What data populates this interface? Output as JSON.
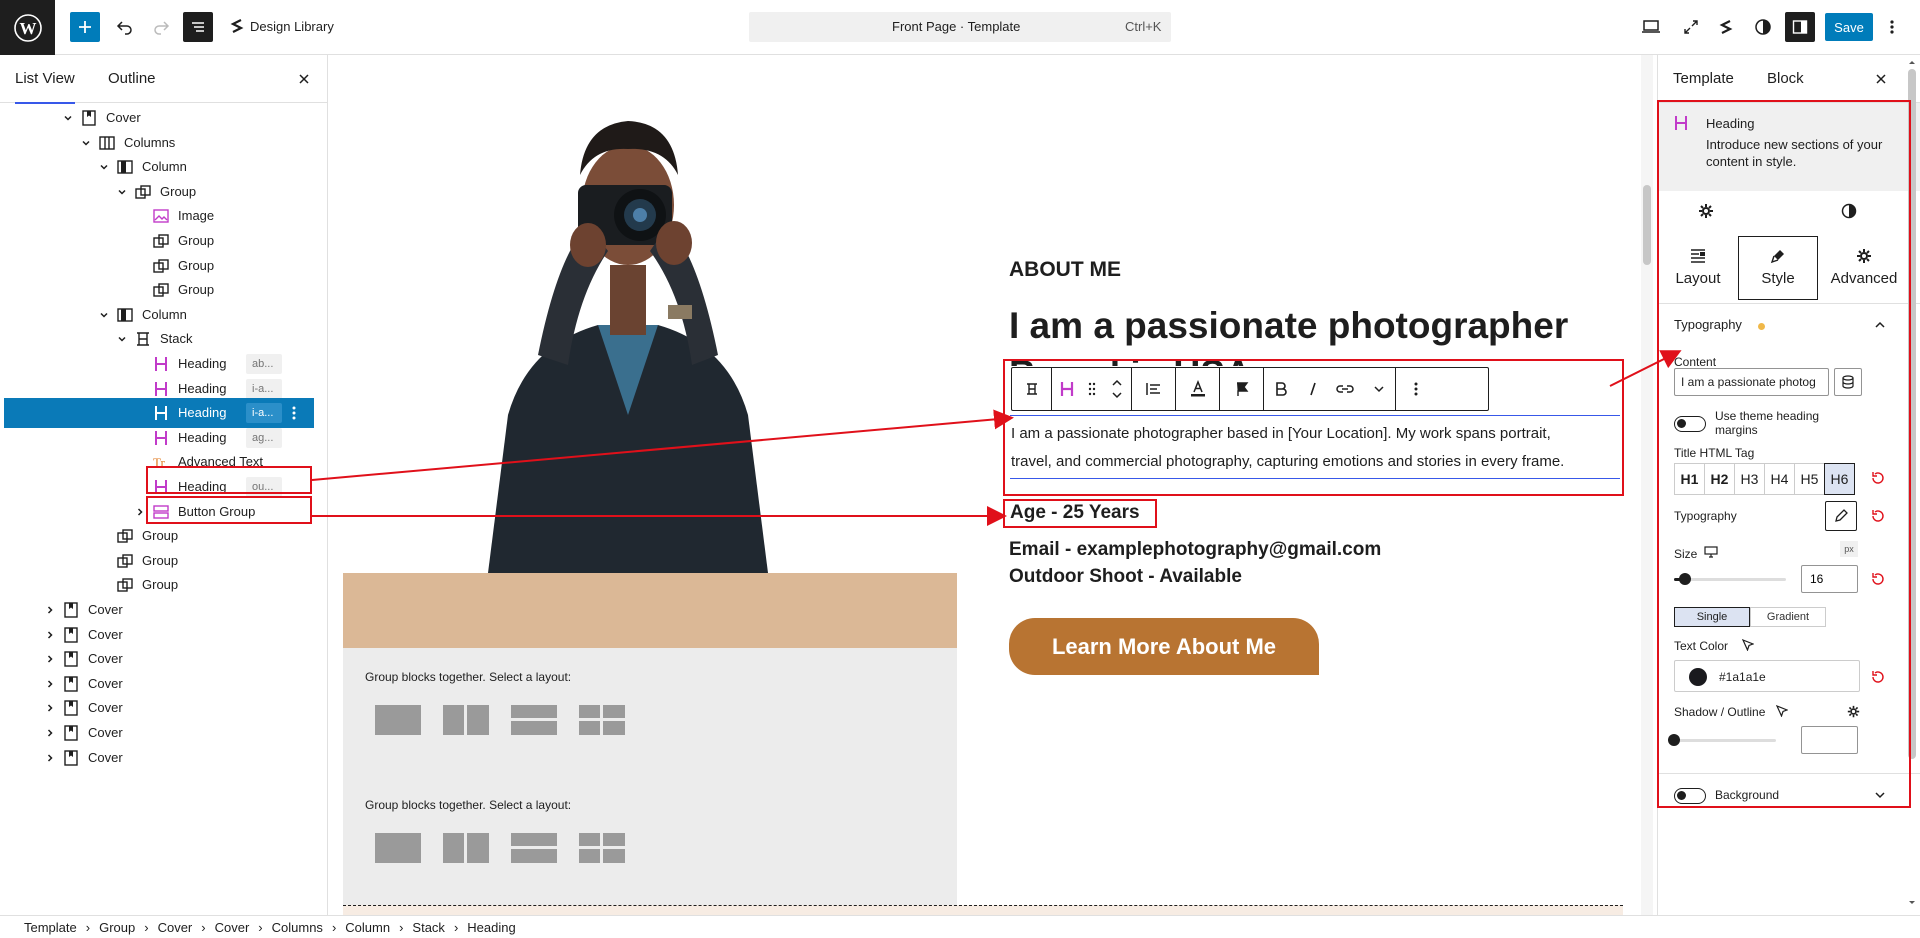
{
  "topbar": {
    "design_library": "Design Library",
    "doc_title": "Front Page · Template",
    "shortcut": "Ctrl+K",
    "save": "Save"
  },
  "left_panel": {
    "tabs": [
      "List View",
      "Outline"
    ],
    "rows": [
      {
        "label": "Cover",
        "icon": "cover-icon",
        "pill": ""
      },
      {
        "label": "Columns",
        "icon": "columns-icon",
        "pill": ""
      },
      {
        "label": "Column",
        "icon": "column-icon",
        "pill": ""
      },
      {
        "label": "Group",
        "icon": "group-icon",
        "pill": ""
      },
      {
        "label": "Image",
        "icon": "image-icon",
        "pill": ""
      },
      {
        "label": "Group",
        "icon": "group-icon",
        "pill": ""
      },
      {
        "label": "Group",
        "icon": "group-icon",
        "pill": ""
      },
      {
        "label": "Group",
        "icon": "group-icon",
        "pill": ""
      },
      {
        "label": "Column",
        "icon": "column-icon",
        "pill": ""
      },
      {
        "label": "Stack",
        "icon": "stack-icon",
        "pill": ""
      },
      {
        "label": "Heading",
        "icon": "heading-icon",
        "pill": "ab..."
      },
      {
        "label": "Heading",
        "icon": "heading-icon",
        "pill": "i-a..."
      },
      {
        "label": "Heading",
        "icon": "heading-icon",
        "pill": "i-a..."
      },
      {
        "label": "Heading",
        "icon": "heading-icon",
        "pill": "ag..."
      },
      {
        "label": "Advanced Text",
        "icon": "advanced-text-icon",
        "pill": ""
      },
      {
        "label": "Heading",
        "icon": "heading-icon",
        "pill": "ou..."
      },
      {
        "label": "Button Group",
        "icon": "button-group-icon",
        "pill": ""
      },
      {
        "label": "Group",
        "icon": "group-icon",
        "pill": ""
      },
      {
        "label": "Group",
        "icon": "group-icon",
        "pill": ""
      },
      {
        "label": "Group",
        "icon": "group-icon",
        "pill": ""
      },
      {
        "label": "Cover",
        "icon": "cover-icon",
        "pill": ""
      },
      {
        "label": "Cover",
        "icon": "cover-icon",
        "pill": ""
      },
      {
        "label": "Cover",
        "icon": "cover-icon",
        "pill": ""
      },
      {
        "label": "Cover",
        "icon": "cover-icon",
        "pill": ""
      },
      {
        "label": "Cover",
        "icon": "cover-icon",
        "pill": ""
      },
      {
        "label": "Cover",
        "icon": "cover-icon",
        "pill": ""
      },
      {
        "label": "Cover",
        "icon": "cover-icon",
        "pill": ""
      }
    ]
  },
  "canvas": {
    "about_label": "ABOUT ME",
    "headline": "I am a passionate photographer",
    "headline_cut": "Based in USA",
    "paragraph_1": "I am a passionate photographer based in [Your Location]. My work spans portrait,",
    "paragraph_2": "travel, and commercial photography, capturing emotions and stories in every frame.",
    "age": "Age - 25 Years",
    "email": "Email - examplephotography@gmail.com",
    "outdoor": "Outdoor Shoot - Available",
    "button": "Learn More About Me",
    "group_prompt_1": "Group blocks together. Select a layout:",
    "group_prompt_2": "Group blocks together. Select a layout:"
  },
  "right_panel": {
    "tabs": [
      "Template",
      "Block"
    ],
    "block_title": "Heading",
    "block_desc_1": "Introduce new sections of your",
    "block_desc_2": "content in style.",
    "style_tabs": [
      "Layout",
      "Style",
      "Advanced"
    ],
    "typography_section": "Typography",
    "content_label": "Content",
    "content_value": "I am a passionate photog",
    "theme_margins_1": "Use theme heading",
    "theme_margins_2": "margins",
    "html_tag_label": "Title HTML Tag",
    "tags": [
      "H1",
      "H2",
      "H3",
      "H4",
      "H5",
      "H6"
    ],
    "typography_label": "Typography",
    "size_label": "Size",
    "size_unit": "px",
    "size_value": "16",
    "size_slider_fraction": 0.1,
    "color_modes": [
      "Single",
      "Gradient"
    ],
    "text_color_label": "Text Color",
    "text_color_value": "#1a1a1e",
    "shadow_label": "Shadow / Outline",
    "background_label": "Background"
  },
  "breadcrumb": [
    "Template",
    "Group",
    "Cover",
    "Cover",
    "Columns",
    "Column",
    "Stack",
    "Heading"
  ],
  "colors": {
    "accent": "#007cba",
    "selection": "#0a7ab8",
    "annotation": "#e0101a",
    "button_brown": "#b87432",
    "tan_band": "#dbb896",
    "heading_purple": "#c13bc9"
  }
}
